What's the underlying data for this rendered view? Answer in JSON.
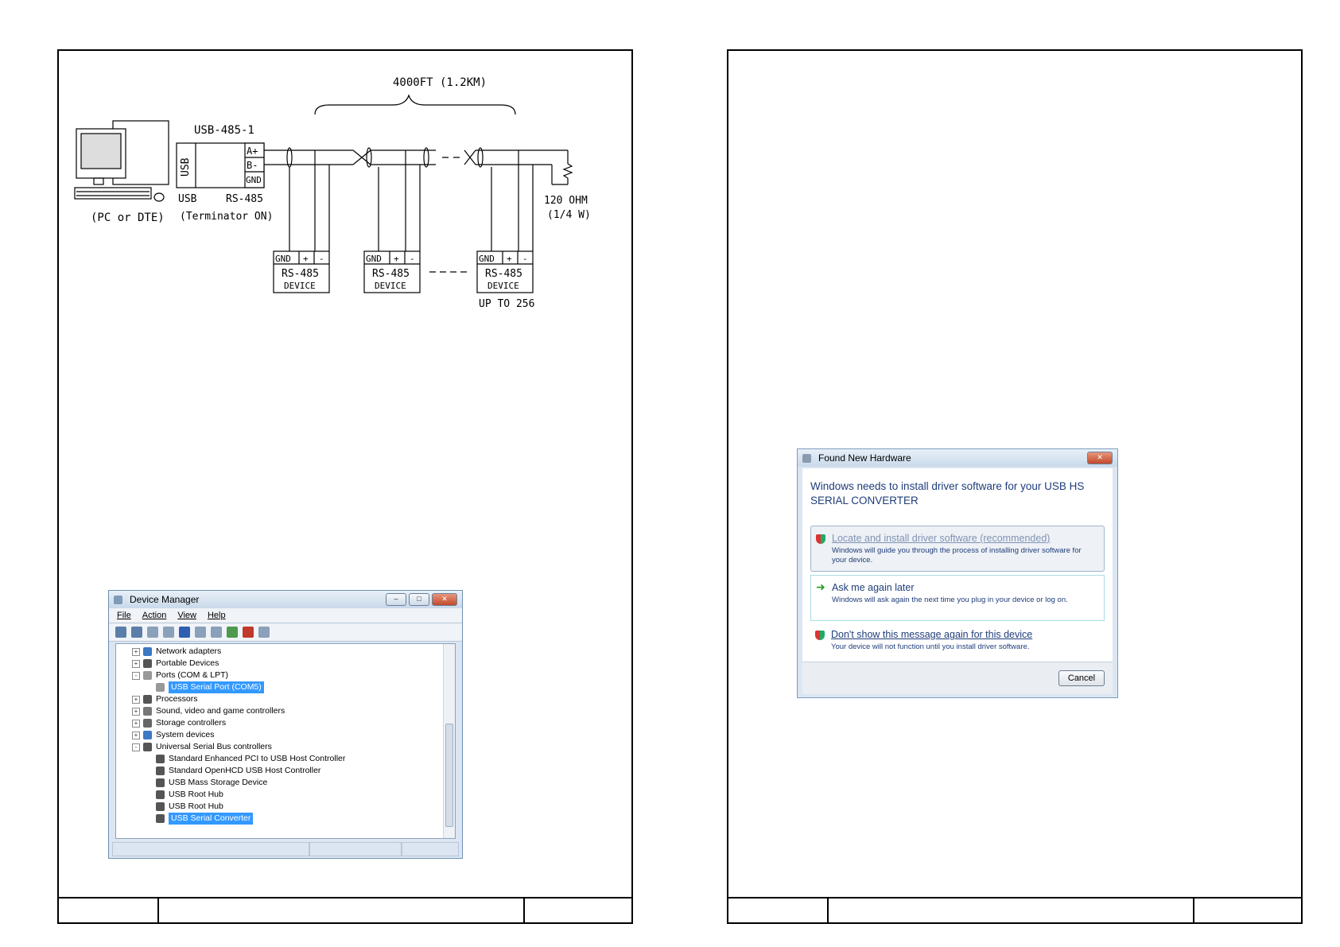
{
  "diagram": {
    "distance_label": "4000FT (1.2KM)",
    "converter_label": "USB-485-1",
    "usb_port_label": "USB",
    "terminal_labels": [
      "A+",
      "B-",
      "GND"
    ],
    "usb_caption": "USB",
    "rs485_caption": "RS-485",
    "terminator_caption": "(Terminator ON)",
    "pc_caption": "(PC or DTE)",
    "resistor_value": "120 OHM",
    "resistor_power": "(1/4 W)",
    "device_terminals": [
      "GND",
      "+",
      "-"
    ],
    "device_title": "RS-485",
    "device_subtitle": "DEVICE",
    "up_to_label": "UP TO 256"
  },
  "device_manager": {
    "title": "Device Manager",
    "menu": [
      "File",
      "Action",
      "View",
      "Help"
    ],
    "tree": [
      {
        "label": "Network adapters",
        "level": 0,
        "expander": "+"
      },
      {
        "label": "Portable Devices",
        "level": 0,
        "expander": "+"
      },
      {
        "label": "Ports (COM & LPT)",
        "level": 0,
        "expander": "-"
      },
      {
        "label": "USB Serial Port (COM5)",
        "level": 1,
        "expander": "",
        "selected": true
      },
      {
        "label": "Processors",
        "level": 0,
        "expander": "+"
      },
      {
        "label": "Sound, video and game controllers",
        "level": 0,
        "expander": "+"
      },
      {
        "label": "Storage controllers",
        "level": 0,
        "expander": "+"
      },
      {
        "label": "System devices",
        "level": 0,
        "expander": "+"
      },
      {
        "label": "Universal Serial Bus controllers",
        "level": 0,
        "expander": "-"
      },
      {
        "label": "Standard Enhanced PCI to USB Host Controller",
        "level": 1,
        "expander": ""
      },
      {
        "label": "Standard OpenHCD USB Host Controller",
        "level": 1,
        "expander": ""
      },
      {
        "label": "USB Mass Storage Device",
        "level": 1,
        "expander": ""
      },
      {
        "label": "USB Root Hub",
        "level": 1,
        "expander": ""
      },
      {
        "label": "USB Root Hub",
        "level": 1,
        "expander": ""
      },
      {
        "label": "USB Serial Converter",
        "level": 1,
        "expander": "",
        "selected": true
      }
    ]
  },
  "found_new_hardware": {
    "title": "Found New Hardware",
    "heading": "Windows needs to install driver software for your USB HS SERIAL CONVERTER",
    "options": [
      {
        "title": "Locate and install driver software (recommended)",
        "desc": "Windows will guide you through the process of installing driver software for your device."
      },
      {
        "title": "Ask me again later",
        "desc": "Windows will ask again the next time you plug in your device or log on."
      },
      {
        "title": "Don't show this message again for this device",
        "desc": "Your device will not function until you install driver software."
      }
    ],
    "cancel_label": "Cancel"
  },
  "colors": {
    "accent": "#1f3d7a",
    "selection": "#3399ff"
  }
}
